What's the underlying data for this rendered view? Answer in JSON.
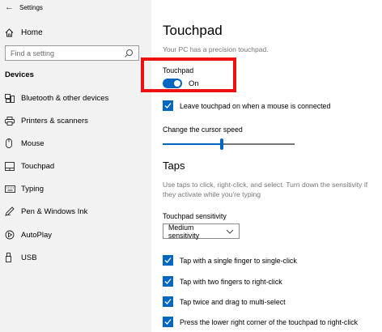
{
  "window": {
    "title": "Settings"
  },
  "sidebar": {
    "home_label": "Home",
    "search_placeholder": "Find a setting",
    "section_title": "Devices",
    "items": [
      {
        "label": "Bluetooth & other devices",
        "icon": "bluetooth-devices-icon"
      },
      {
        "label": "Printers & scanners",
        "icon": "printer-icon"
      },
      {
        "label": "Mouse",
        "icon": "mouse-icon"
      },
      {
        "label": "Touchpad",
        "icon": "touchpad-icon"
      },
      {
        "label": "Typing",
        "icon": "keyboard-icon"
      },
      {
        "label": "Pen & Windows Ink",
        "icon": "pen-icon"
      },
      {
        "label": "AutoPlay",
        "icon": "autoplay-icon"
      },
      {
        "label": "USB",
        "icon": "usb-icon"
      }
    ]
  },
  "main": {
    "title": "Touchpad",
    "subtitle": "Your PC has a precision touchpad.",
    "touchpad_toggle": {
      "label": "Touchpad",
      "state_label": "On",
      "on": true
    },
    "leave_on_checkbox": {
      "label": "Leave touchpad on when a mouse is connected",
      "checked": true
    },
    "cursor_speed": {
      "label": "Change the cursor speed",
      "fraction": 0.52
    },
    "taps": {
      "heading": "Taps",
      "description": "Use taps to click, right-click, and select. Turn down the sensitivity if they activate while you're typing",
      "sensitivity_label": "Touchpad sensitivity",
      "sensitivity_value": "Medium sensitivity",
      "options": [
        {
          "label": "Tap with a single finger to single-click",
          "checked": true
        },
        {
          "label": "Tap with two fingers to right-click",
          "checked": true
        },
        {
          "label": "Tap twice and drag to multi-select",
          "checked": true
        },
        {
          "label": "Press the lower right corner of the touchpad to right-click",
          "checked": true
        }
      ]
    }
  },
  "colors": {
    "accent": "#0067c0",
    "highlight": "#ee1111",
    "sidebar_bg": "#f2f2f2"
  }
}
